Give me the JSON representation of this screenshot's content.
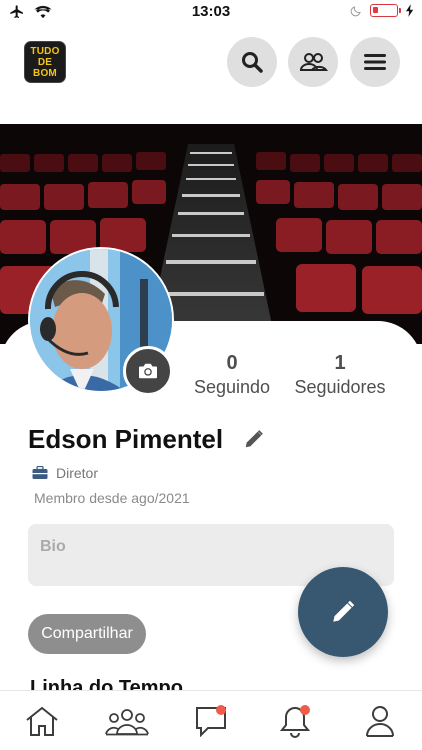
{
  "status_bar": {
    "time": "13:03",
    "icons": [
      "airplane-icon",
      "wifi-icon",
      "moon-icon",
      "battery-icon",
      "charging-icon"
    ],
    "battery_color": "#d9393e"
  },
  "header": {
    "logo_lines": [
      "TUDO",
      "DE",
      "BOM"
    ],
    "logo_text_color": "#f3c414",
    "buttons": [
      "search-icon",
      "groups-icon",
      "menu-icon"
    ]
  },
  "profile": {
    "name": "Edson Pimentel",
    "role": "Diretor",
    "member_since": "Membro desde ago/2021",
    "bio_placeholder": "Bio",
    "stats": {
      "following_count": "0",
      "following_label": "Seguindo",
      "followers_count": "1",
      "followers_label": "Seguidores"
    }
  },
  "actions": {
    "share_label": "Compartilhar",
    "fab_icon": "pencil-icon",
    "fab_color": "#385771"
  },
  "sections": {
    "timeline_title": "Linha do Tempo"
  },
  "tab_bar": {
    "items": [
      {
        "icon": "home-icon",
        "badge": false
      },
      {
        "icon": "community-icon",
        "badge": false
      },
      {
        "icon": "chat-icon",
        "badge": true
      },
      {
        "icon": "bell-icon",
        "badge": true
      },
      {
        "icon": "profile-icon",
        "badge": false
      }
    ],
    "badge_color": "#ee5b4a"
  }
}
